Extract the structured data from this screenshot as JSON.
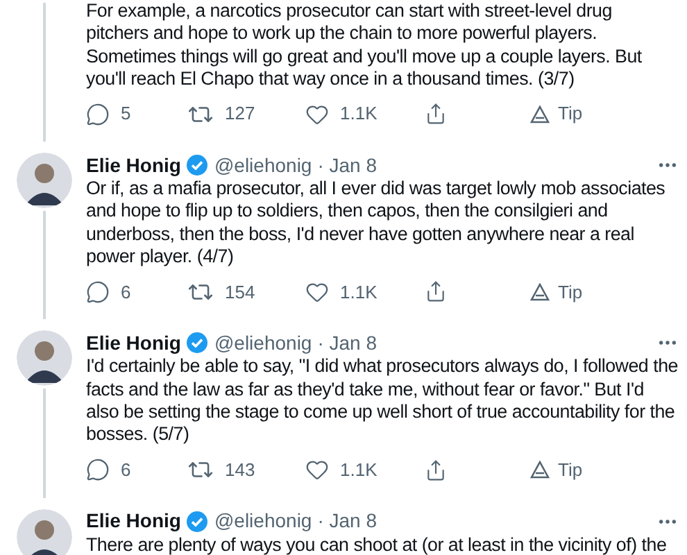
{
  "tweets": [
    {
      "text": "For example, a narcotics prosecutor can start with street-level drug pitchers and hope to work up the chain to more powerful players. Sometimes things will go great and you'll move up a couple layers. But you'll reach El Chapo that way once in a thousand times. (3/7)",
      "actions": {
        "replies": "5",
        "retweets": "127",
        "likes": "1.1K",
        "tip": "Tip"
      }
    },
    {
      "author": "Elie Honig",
      "verified": true,
      "handle": "@eliehonig",
      "date": "· Jan 8",
      "text": "Or if, as a mafia prosecutor, all I ever did was target lowly mob associates and hope to flip up to soldiers, then capos, then the consilgieri and underboss, then the boss, I'd never have gotten anywhere near a real power player. (4/7)",
      "actions": {
        "replies": "6",
        "retweets": "154",
        "likes": "1.1K",
        "tip": "Tip"
      }
    },
    {
      "author": "Elie Honig",
      "verified": true,
      "handle": "@eliehonig",
      "date": "· Jan 8",
      "text": "I'd certainly be able to say, \"I did what prosecutors always do, I followed the facts and the law as far as they'd take me, without fear or favor.\" But I'd also be setting the stage to come up well short of true accountability for the bosses. (5/7)",
      "actions": {
        "replies": "6",
        "retweets": "143",
        "likes": "1.1K",
        "tip": "Tip"
      }
    },
    {
      "author": "Elie Honig",
      "verified": true,
      "handle": "@eliehonig",
      "date": "· Jan 8",
      "text": "There are plenty of ways you can shoot at (or at least in the vicinity of) the"
    }
  ]
}
